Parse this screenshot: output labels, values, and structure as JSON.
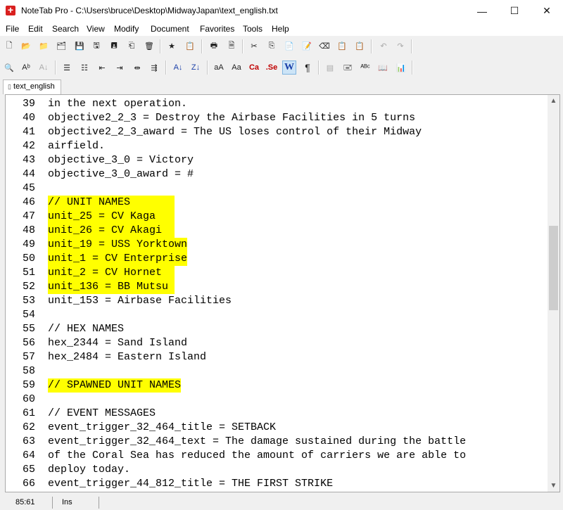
{
  "window": {
    "title": "NoteTab Pro  -  C:\\Users\\bruce\\Desktop\\MidwayJapan\\text_english.txt",
    "minimize": "—",
    "maximize": "☐",
    "close": "✕"
  },
  "menu": [
    "File",
    "Edit",
    "Search",
    "View",
    "Modify",
    "Document",
    "Favorites",
    "Tools",
    "Help"
  ],
  "toolbar1": {
    "new": "🗋",
    "open": "📂",
    "open_folder": "📁",
    "save_all_files": "🗂",
    "save": "💾",
    "save_as": "🖫",
    "save_all": "🖪",
    "revert": "⎗",
    "delete": "🗑",
    "favorites": "★",
    "clipbook": "📋",
    "print": "🖶",
    "print_preview": "🗎",
    "cut": "✂",
    "copy": "⎘",
    "paste": "📄",
    "paste_special": "📝",
    "erase": "⌫",
    "clipboard1": "📋",
    "clipboard2": "📋",
    "undo": "↶",
    "redo": "↷"
  },
  "toolbar2": {
    "find": "🔍",
    "replace": "Aᵇ",
    "find_next": "A↓",
    "bullets": "☰",
    "numbered": "☷",
    "outdent": "⇤",
    "indent": "⇥",
    "align": "⇹",
    "join": "⇶",
    "sort_asc": "A↓",
    "sort_desc": "Z↓",
    "lowercase": "aA",
    "uppercase": "Aa",
    "capitalize": "Ca",
    "sentence": ".Se",
    "word_wrap": "W",
    "pilcrow": "¶",
    "cols": "▤",
    "clip": "🖃",
    "spell": "ᴬᴮᶜ",
    "book": "📖",
    "stats": "📊"
  },
  "tab": {
    "label": "text_english"
  },
  "editor": {
    "lines": [
      {
        "n": "39",
        "text": "in the next operation.",
        "hl": false
      },
      {
        "n": "40",
        "text": "objective2_2_3 = Destroy the Airbase Facilities in 5 turns",
        "hl": false
      },
      {
        "n": "41",
        "text": "objective2_2_3_award = The US loses control of their Midway",
        "hl": false
      },
      {
        "n": "42",
        "text": "airfield.",
        "hl": false
      },
      {
        "n": "43",
        "text": "objective_3_0 = Victory",
        "hl": false
      },
      {
        "n": "44",
        "text": "objective_3_0_award = #",
        "hl": false
      },
      {
        "n": "45",
        "text": "",
        "hl": false
      },
      {
        "n": "46",
        "text": "// UNIT NAMES       ",
        "hl": true
      },
      {
        "n": "47",
        "text": "unit_25 = CV Kaga   ",
        "hl": true
      },
      {
        "n": "48",
        "text": "unit_26 = CV Akagi  ",
        "hl": true
      },
      {
        "n": "49",
        "text": "unit_19 = USS Yorktown",
        "hl": true
      },
      {
        "n": "50",
        "text": "unit_1 = CV Enterprise",
        "hl": true
      },
      {
        "n": "51",
        "text": "unit_2 = CV Hornet  ",
        "hl": true
      },
      {
        "n": "52",
        "text": "unit_136 = BB Mutsu ",
        "hl": true
      },
      {
        "n": "53",
        "text": "unit_153 = Airbase Facilities",
        "hl": false
      },
      {
        "n": "54",
        "text": "",
        "hl": false
      },
      {
        "n": "55",
        "text": "// HEX NAMES",
        "hl": false
      },
      {
        "n": "56",
        "text": "hex_2344 = Sand Island",
        "hl": false
      },
      {
        "n": "57",
        "text": "hex_2484 = Eastern Island",
        "hl": false
      },
      {
        "n": "58",
        "text": "",
        "hl": false
      },
      {
        "n": "59",
        "text": "// SPAWNED UNIT NAMES",
        "hl": true
      },
      {
        "n": "60",
        "text": "",
        "hl": false
      },
      {
        "n": "61",
        "text": "// EVENT MESSAGES",
        "hl": false
      },
      {
        "n": "62",
        "text": "event_trigger_32_464_title = SETBACK",
        "hl": false
      },
      {
        "n": "63",
        "text": "event_trigger_32_464_text = The damage sustained during the battle",
        "hl": false
      },
      {
        "n": "64",
        "text": "of the Coral Sea has reduced the amount of carriers we are able to",
        "hl": false
      },
      {
        "n": "65",
        "text": "deploy today.",
        "hl": false
      },
      {
        "n": "66",
        "text": "event_trigger_44_812_title = THE FIRST STRIKE",
        "hl": false
      }
    ]
  },
  "scroll": {
    "up": "▲",
    "down": "▼"
  },
  "status": {
    "position": "85:61",
    "mode": "Ins"
  },
  "colors": {
    "highlight": "#ffff00",
    "app_icon": "#d9201f"
  }
}
